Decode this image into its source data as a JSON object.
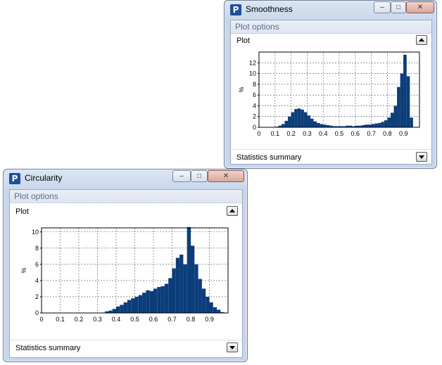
{
  "smoothness_window": {
    "title": "Smoothness",
    "panel_header": "Plot options",
    "plot_section": "Plot",
    "stats_section": "Statistics summary",
    "controls": {
      "minimize": "–",
      "maximize": "□",
      "close": "✕"
    }
  },
  "circularity_window": {
    "title": "Circularity",
    "panel_header": "Plot options",
    "plot_section": "Plot",
    "stats_section": "Statistics summary",
    "controls": {
      "minimize": "–",
      "maximize": "□",
      "close": "✕"
    }
  },
  "chart_data": [
    {
      "type": "bar",
      "ylabel": "%",
      "xlim": [
        0,
        1.0
      ],
      "ylim": [
        0,
        14
      ],
      "yticks": [
        0,
        2,
        4,
        6,
        8,
        10,
        12
      ],
      "xticks": [
        "0",
        "0.1",
        "0.2",
        "0.3",
        "0.4",
        "0.5",
        "0.6",
        "0.7",
        "0.8",
        "0.9"
      ],
      "bin_width": 0.02,
      "x": [
        0.11,
        0.13,
        0.15,
        0.17,
        0.19,
        0.21,
        0.23,
        0.25,
        0.27,
        0.29,
        0.31,
        0.33,
        0.35,
        0.37,
        0.39,
        0.41,
        0.43,
        0.45,
        0.47,
        0.49,
        0.51,
        0.53,
        0.55,
        0.57,
        0.59,
        0.61,
        0.63,
        0.65,
        0.67,
        0.69,
        0.71,
        0.73,
        0.75,
        0.77,
        0.79,
        0.81,
        0.83,
        0.85,
        0.87,
        0.89,
        0.91,
        0.93,
        0.95
      ],
      "values": [
        0.1,
        0.3,
        0.6,
        1.2,
        2.0,
        2.8,
        3.4,
        3.5,
        3.3,
        2.8,
        2.2,
        1.6,
        1.1,
        0.8,
        0.6,
        0.5,
        0.4,
        0.3,
        0.2,
        0.2,
        0.2,
        0.2,
        0.3,
        0.3,
        0.2,
        0.3,
        0.3,
        0.4,
        0.5,
        0.5,
        0.6,
        0.7,
        0.8,
        1.0,
        1.3,
        1.8,
        2.7,
        4.0,
        7.5,
        10.0,
        13.5,
        9.5,
        1.8
      ],
      "grid": true,
      "color": "#0b3d7a"
    },
    {
      "type": "bar",
      "ylabel": "%",
      "xlim": [
        0,
        1.0
      ],
      "ylim": [
        0,
        10.5
      ],
      "yticks": [
        0,
        2,
        4,
        6,
        8,
        10
      ],
      "xticks": [
        "0",
        "0.1",
        "0.2",
        "0.3",
        "0.4",
        "0.5",
        "0.6",
        "0.7",
        "0.8",
        "0.9"
      ],
      "bin_width": 0.02,
      "x": [
        0.33,
        0.35,
        0.37,
        0.39,
        0.41,
        0.43,
        0.45,
        0.47,
        0.49,
        0.51,
        0.53,
        0.55,
        0.57,
        0.59,
        0.61,
        0.63,
        0.65,
        0.67,
        0.69,
        0.71,
        0.73,
        0.75,
        0.77,
        0.79,
        0.81,
        0.83,
        0.85,
        0.87,
        0.89,
        0.91,
        0.93,
        0.95,
        0.97
      ],
      "values": [
        0.05,
        0.2,
        0.3,
        0.5,
        0.8,
        1.0,
        1.3,
        1.6,
        1.8,
        2.0,
        2.2,
        2.5,
        2.8,
        2.7,
        3.0,
        3.2,
        3.3,
        3.6,
        4.3,
        5.5,
        6.8,
        7.2,
        6.0,
        10.6,
        8.3,
        6.0,
        4.2,
        3.0,
        2.0,
        1.3,
        0.7,
        0.4,
        0.1
      ],
      "grid": true,
      "color": "#0b3d7a"
    }
  ]
}
